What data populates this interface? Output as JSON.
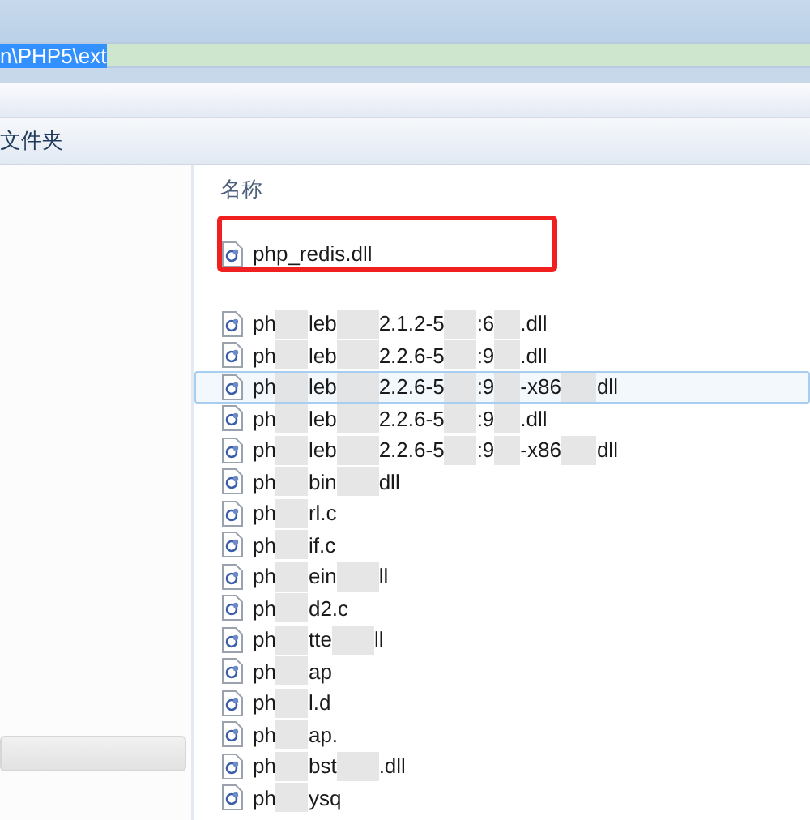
{
  "address_bar": {
    "path": "n\\PHP5\\ext"
  },
  "toolbar": {
    "label": "文件夹"
  },
  "file_list": {
    "column_header": "名称",
    "files": [
      {
        "segments": [
          "php_redis.dll"
        ],
        "selected": false,
        "highlighted": true
      },
      {
        "segments": [
          "ph",
          "leb",
          "2.1.2-5",
          ":6",
          ".dll"
        ],
        "selected": false,
        "highlighted": false
      },
      {
        "segments": [
          "ph",
          "leb",
          "2.2.6-5",
          ":9",
          ".dll"
        ],
        "selected": false,
        "highlighted": false
      },
      {
        "segments": [
          "ph",
          "leb",
          "2.2.6-5",
          ":9",
          "-x86",
          "dll"
        ],
        "selected": true,
        "highlighted": false
      },
      {
        "segments": [
          "ph",
          "leb",
          "2.2.6-5",
          ":9",
          ".dll"
        ],
        "selected": false,
        "highlighted": false
      },
      {
        "segments": [
          "ph",
          "leb",
          "2.2.6-5",
          ":9",
          "-x86",
          "dll"
        ],
        "selected": false,
        "highlighted": false
      },
      {
        "segments": [
          "ph",
          "bin",
          "dll"
        ],
        "selected": false,
        "highlighted": false
      },
      {
        "segments": [
          "ph",
          "rl.c"
        ],
        "selected": false,
        "highlighted": false
      },
      {
        "segments": [
          "ph",
          "if.c"
        ],
        "selected": false,
        "highlighted": false
      },
      {
        "segments": [
          "ph",
          "ein",
          "ll"
        ],
        "selected": false,
        "highlighted": false
      },
      {
        "segments": [
          "ph",
          "d2.c"
        ],
        "selected": false,
        "highlighted": false
      },
      {
        "segments": [
          "ph",
          "tte",
          "ll"
        ],
        "selected": false,
        "highlighted": false
      },
      {
        "segments": [
          "ph",
          "ap"
        ],
        "selected": false,
        "highlighted": false
      },
      {
        "segments": [
          "ph",
          "l.d"
        ],
        "selected": false,
        "highlighted": false
      },
      {
        "segments": [
          "ph",
          "ap."
        ],
        "selected": false,
        "highlighted": false
      },
      {
        "segments": [
          "ph",
          "bst",
          ".dll"
        ],
        "selected": false,
        "highlighted": false
      },
      {
        "segments": [
          "ph",
          "ysq"
        ],
        "selected": false,
        "highlighted": false
      }
    ]
  }
}
